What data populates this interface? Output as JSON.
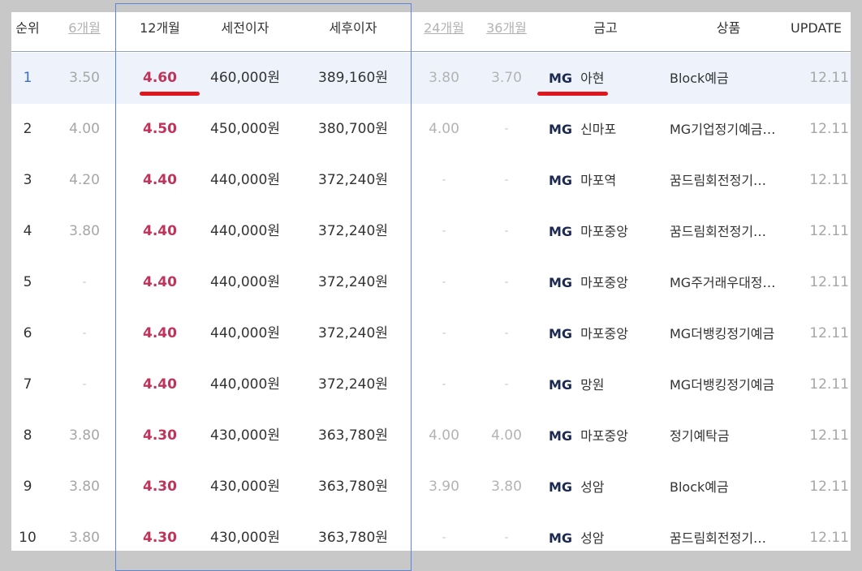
{
  "header": {
    "rank": "순위",
    "m6": "6개월",
    "m12": "12개월",
    "pre_tax": "세전이자",
    "post_tax": "세후이자",
    "m24": "24개월",
    "m36": "36개월",
    "bank": "금고",
    "product": "상품",
    "update": "UPDATE"
  },
  "bank_prefix": "MG",
  "rows": [
    {
      "rank": "1",
      "m6": "3.50",
      "m12": "4.60",
      "pre": "460,000원",
      "post": "389,160원",
      "m24": "3.80",
      "m36": "3.70",
      "bank": "아현",
      "product": "Block예금",
      "update": "12.11"
    },
    {
      "rank": "2",
      "m6": "4.00",
      "m12": "4.50",
      "pre": "450,000원",
      "post": "380,700원",
      "m24": "4.00",
      "m36": "-",
      "bank": "신마포",
      "product": "MG기업정기예금…",
      "update": "12.11"
    },
    {
      "rank": "3",
      "m6": "4.20",
      "m12": "4.40",
      "pre": "440,000원",
      "post": "372,240원",
      "m24": "-",
      "m36": "-",
      "bank": "마포역",
      "product": "꿈드림회전정기…",
      "update": "12.11"
    },
    {
      "rank": "4",
      "m6": "3.80",
      "m12": "4.40",
      "pre": "440,000원",
      "post": "372,240원",
      "m24": "-",
      "m36": "-",
      "bank": "마포중앙",
      "product": "꿈드림회전정기…",
      "update": "12.11"
    },
    {
      "rank": "5",
      "m6": "-",
      "m12": "4.40",
      "pre": "440,000원",
      "post": "372,240원",
      "m24": "-",
      "m36": "-",
      "bank": "마포중앙",
      "product": "MG주거래우대정…",
      "update": "12.11"
    },
    {
      "rank": "6",
      "m6": "-",
      "m12": "4.40",
      "pre": "440,000원",
      "post": "372,240원",
      "m24": "-",
      "m36": "-",
      "bank": "마포중앙",
      "product": "MG더뱅킹정기예금",
      "update": "12.11"
    },
    {
      "rank": "7",
      "m6": "-",
      "m12": "4.40",
      "pre": "440,000원",
      "post": "372,240원",
      "m24": "-",
      "m36": "-",
      "bank": "망원",
      "product": "MG더뱅킹정기예금",
      "update": "12.11"
    },
    {
      "rank": "8",
      "m6": "3.80",
      "m12": "4.30",
      "pre": "430,000원",
      "post": "363,780원",
      "m24": "4.00",
      "m36": "4.00",
      "bank": "마포중앙",
      "product": "정기예탁금",
      "update": "12.11"
    },
    {
      "rank": "9",
      "m6": "3.80",
      "m12": "4.30",
      "pre": "430,000원",
      "post": "363,780원",
      "m24": "3.90",
      "m36": "3.80",
      "bank": "성암",
      "product": "Block예금",
      "update": "12.11"
    },
    {
      "rank": "10",
      "m6": "3.80",
      "m12": "4.30",
      "pre": "430,000원",
      "post": "363,780원",
      "m24": "-",
      "m36": "-",
      "bank": "성암",
      "product": "꿈드림회전정기…",
      "update": "12.11"
    }
  ],
  "colors": {
    "rate_highlight": "#c0335a",
    "annotation_box": "#5b86d9",
    "annotation_underline": "#e0151d",
    "selected_row_bg": "#eef3fb"
  }
}
